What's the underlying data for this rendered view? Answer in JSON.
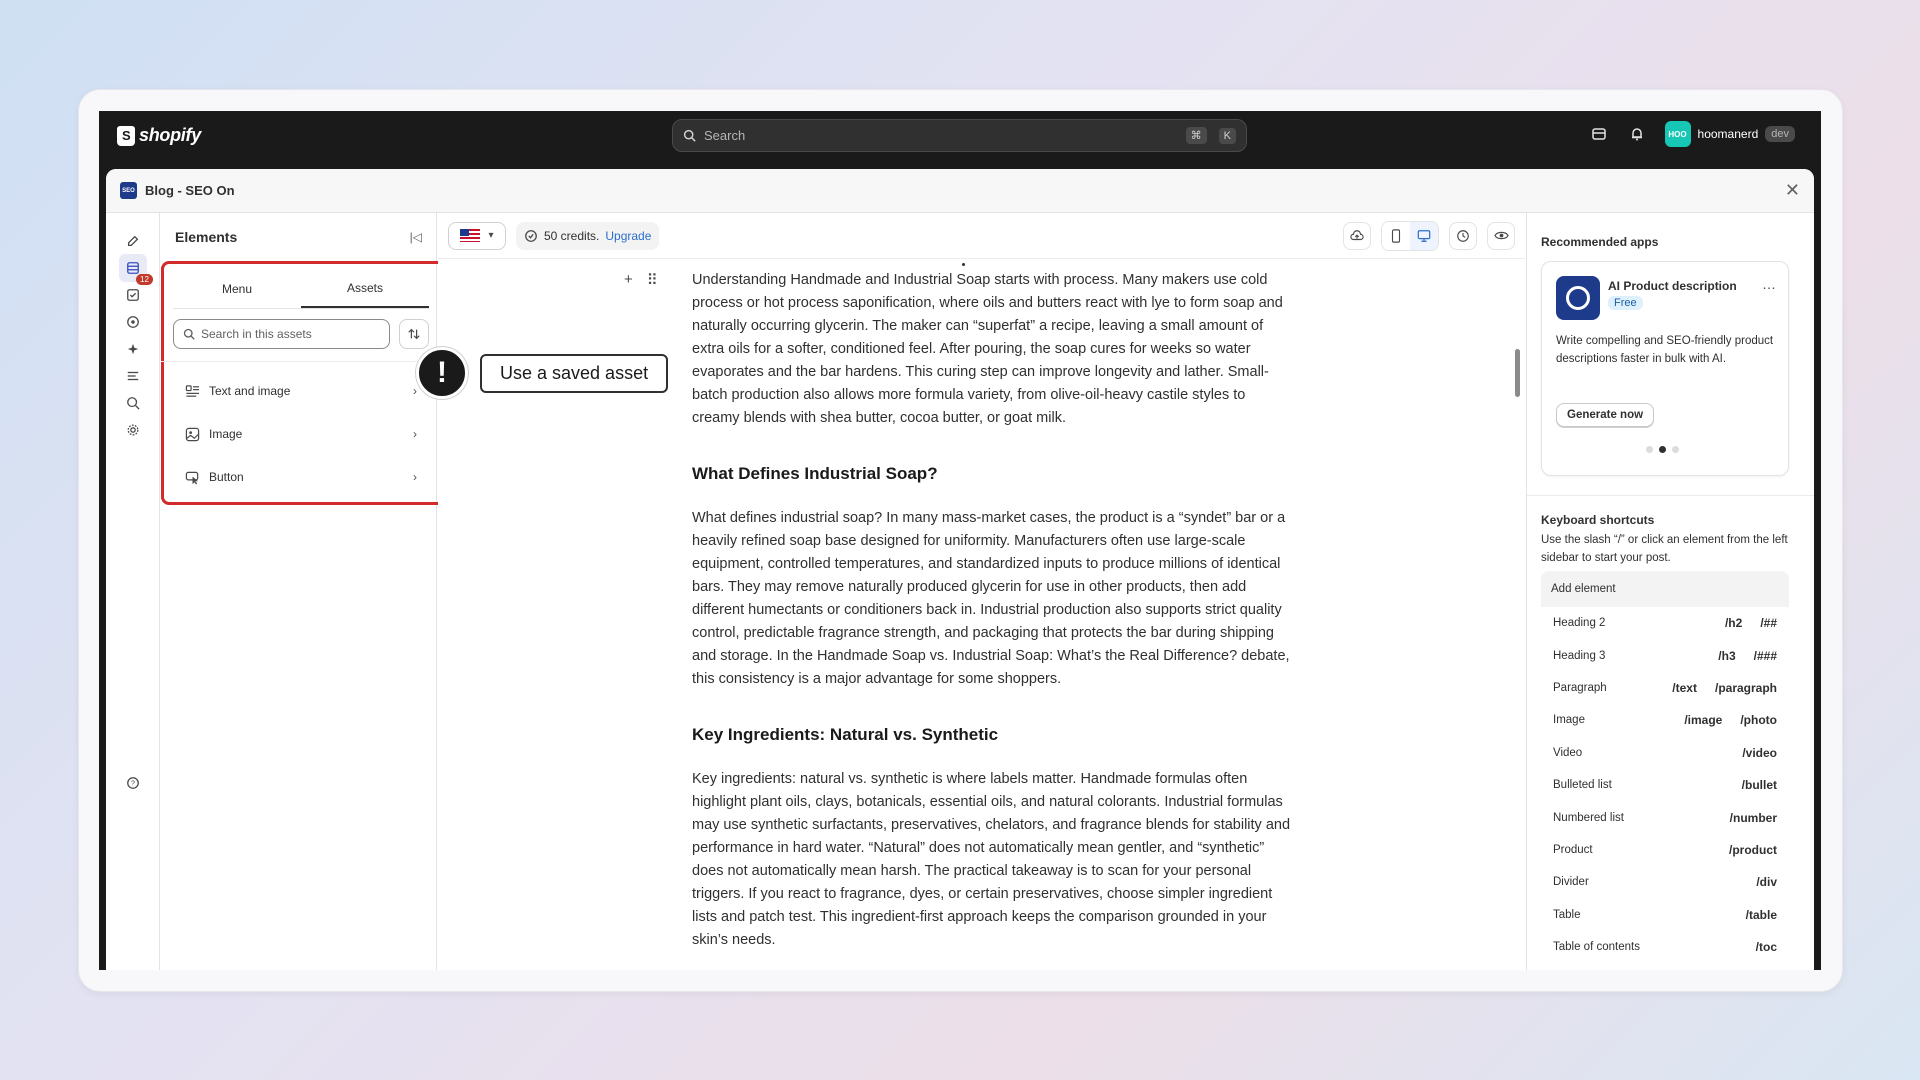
{
  "topbar": {
    "brand": "shopify",
    "search_placeholder": "Search",
    "shortcut_keys": [
      "⌘",
      "K"
    ],
    "user_name": "hoomanerd",
    "user_initials": "HOO",
    "user_badge": "dev"
  },
  "window": {
    "title": "Blog - SEO On",
    "app_icon_text": "SEO"
  },
  "rail": {
    "badge_count": "12",
    "icons": [
      "edit-icon",
      "elements-icon",
      "checklist-icon",
      "image-icon",
      "sparkle-icon",
      "outline-icon",
      "seo-search-icon",
      "settings-icon",
      "help-icon"
    ]
  },
  "elements_panel": {
    "title": "Elements",
    "tabs": [
      {
        "label": "Menu",
        "active": false
      },
      {
        "label": "Assets",
        "active": true
      }
    ],
    "search_placeholder": "Search in this assets",
    "assets": [
      {
        "label": "Text and image",
        "icon": "text-image-icon"
      },
      {
        "label": "Image",
        "icon": "image-icon"
      },
      {
        "label": "Button",
        "icon": "button-cursor-icon"
      }
    ]
  },
  "callout": {
    "symbol": "!",
    "label": "Use a saved asset"
  },
  "toolbar": {
    "credits_text": "50 credits.",
    "upgrade_label": "Upgrade",
    "icons": [
      "cloud-upload-icon",
      "mobile-icon",
      "desktop-icon",
      "history-icon",
      "preview-eye-icon"
    ]
  },
  "article": {
    "p1": "Understanding Handmade and Industrial Soap starts with process. Many makers use cold process or hot process saponification, where oils and butters react with lye to form soap and naturally occurring glycerin. The maker can “superfat” a recipe, leaving a small amount of extra oils for a softer, conditioned feel. After pouring, the soap cures for weeks so water evaporates and the bar hardens. This curing step can improve longevity and lather. Small-batch production also allows more formula variety, from olive-oil-heavy castile styles to creamy blends with shea butter, cocoa butter, or goat milk.",
    "h1": "What Defines Industrial Soap?",
    "p2": "What defines industrial soap? In many mass-market cases, the product is a “syndet” bar or a heavily refined soap base designed for uniformity. Manufacturers often use large-scale equipment, controlled temperatures, and standardized inputs to produce millions of identical bars. They may remove naturally produced glycerin for use in other products, then add different humectants or conditioners back in. Industrial production also supports strict quality control, predictable fragrance strength, and packaging that protects the bar during shipping and storage. In the Handmade Soap vs. Industrial Soap: What’s the Real Difference? debate, this consistency is a major advantage for some shoppers.",
    "h2": "Key Ingredients: Natural vs. Synthetic",
    "p3": "Key ingredients: natural vs. synthetic is where labels matter. Handmade formulas often highlight plant oils, clays, botanicals, essential oils, and natural colorants. Industrial formulas may use synthetic surfactants, preservatives, chelators, and fragrance blends for stability and performance in hard water. “Natural” does not automatically mean gentler, and “synthetic” does not automatically mean harsh. The practical takeaway is to scan for your personal triggers. If you react to fragrance, dyes, or certain preservatives, choose simpler ingredient lists and patch test. This ingredient-first approach keeps the comparison grounded in your skin’s needs."
  },
  "recommended": {
    "title": "Recommended apps",
    "app_name": "AI Product description",
    "badge": "Free",
    "description": "Write compelling and SEO-friendly product descriptions faster in bulk with AI.",
    "cta": "Generate now",
    "more": "…"
  },
  "shortcuts": {
    "title": "Keyboard shortcuts",
    "description": "Use the slash “/” or click an element from the left sidebar to start your post.",
    "header": "Add element",
    "rows": [
      {
        "label": "Heading 2",
        "keys": [
          "/h2",
          "/##"
        ]
      },
      {
        "label": "Heading 3",
        "keys": [
          "/h3",
          "/###"
        ]
      },
      {
        "label": "Paragraph",
        "keys": [
          "/text",
          "/paragraph"
        ]
      },
      {
        "label": "Image",
        "keys": [
          "/image",
          "/photo"
        ]
      },
      {
        "label": "Video",
        "keys": [
          "/video"
        ]
      },
      {
        "label": "Bulleted list",
        "keys": [
          "/bullet"
        ]
      },
      {
        "label": "Numbered list",
        "keys": [
          "/number"
        ]
      },
      {
        "label": "Product",
        "keys": [
          "/product"
        ]
      },
      {
        "label": "Divider",
        "keys": [
          "/div"
        ]
      },
      {
        "label": "Table",
        "keys": [
          "/table"
        ]
      },
      {
        "label": "Table of contents",
        "keys": [
          "/toc"
        ]
      }
    ]
  }
}
